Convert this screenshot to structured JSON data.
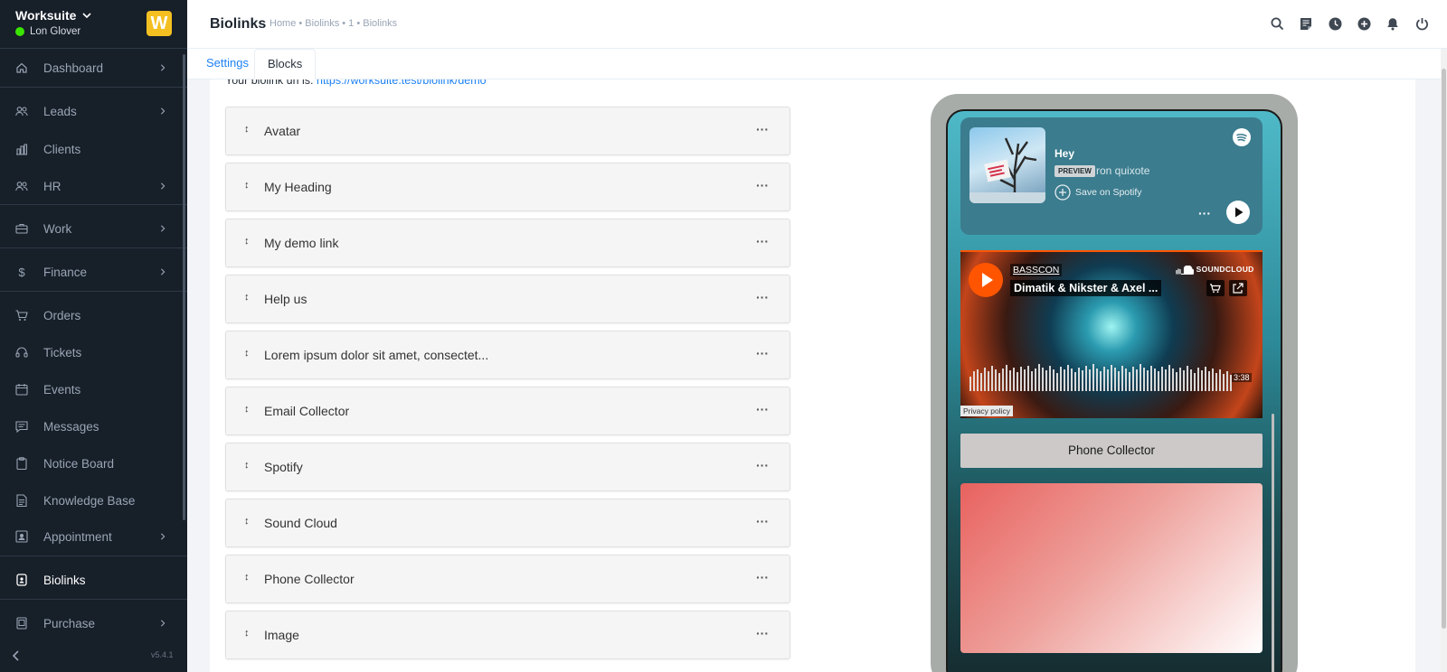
{
  "sidebar": {
    "company": "Worksuite",
    "user": "Lon Glover",
    "logo_letter": "W",
    "version": "v5.4.1",
    "items": [
      {
        "label": "Dashboard"
      },
      {
        "label": "Leads"
      },
      {
        "label": "Clients"
      },
      {
        "label": "HR"
      },
      {
        "label": "Work"
      },
      {
        "label": "Finance"
      },
      {
        "label": "Orders"
      },
      {
        "label": "Tickets"
      },
      {
        "label": "Events"
      },
      {
        "label": "Messages"
      },
      {
        "label": "Notice Board"
      },
      {
        "label": "Knowledge Base"
      },
      {
        "label": "Appointment"
      },
      {
        "label": "Biolinks"
      },
      {
        "label": "Purchase"
      }
    ]
  },
  "header": {
    "title": "Biolinks",
    "breadcrumb": "Home • Biolinks • 1 • Biolinks"
  },
  "tabs": {
    "settings": "Settings",
    "blocks": "Blocks"
  },
  "content": {
    "url_prefix": "Your biolink url is:",
    "url": "https://worksuite.test/biolink/demo"
  },
  "blocks": [
    {
      "name": "Avatar"
    },
    {
      "name": "My Heading"
    },
    {
      "name": "My demo link"
    },
    {
      "name": "Help us"
    },
    {
      "name": "Lorem ipsum dolor sit amet, consectet..."
    },
    {
      "name": "Email Collector"
    },
    {
      "name": "Spotify"
    },
    {
      "name": "Sound Cloud"
    },
    {
      "name": "Phone Collector"
    },
    {
      "name": "Image"
    }
  ],
  "preview": {
    "spotify": {
      "title": "Hey",
      "badge": "PREVIEW",
      "artist": "ron quixote",
      "save": "Save on Spotify"
    },
    "soundcloud": {
      "user": "BASSCON",
      "track": "Dimatik & Nikster & Axel ...",
      "logo": "SOUNDCLOUD",
      "duration": "3:38",
      "privacy": "Privacy policy"
    },
    "phone_collector": "Phone Collector"
  },
  "colors": {
    "sidebar_bg": "#171f29",
    "accent": "#1d82f5",
    "logo": "#f4c021",
    "soundcloud": "#ff5500"
  }
}
